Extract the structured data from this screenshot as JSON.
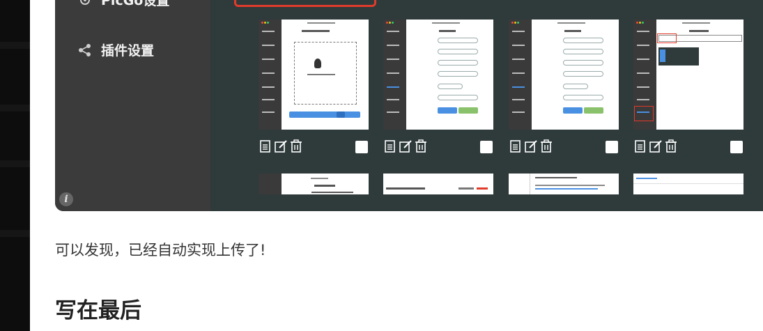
{
  "sidebar": {
    "items": [
      {
        "label": "PicGo设置",
        "icon": "gear-icon"
      },
      {
        "label": "插件设置",
        "icon": "share-icon"
      }
    ]
  },
  "gallery": {
    "row1_count": 4,
    "row2_count": 4,
    "actions": [
      "document-icon",
      "edit-icon",
      "trash-icon"
    ]
  },
  "article": {
    "caption": "可以发现，已经自动实现上传了!",
    "heading": "写在最后"
  },
  "colors": {
    "panel_bg": "#2f3a3b",
    "sidebar_bg": "#3b3b3b",
    "highlight_red": "#e13b2b",
    "accent_blue": "#4a90e2",
    "accent_green": "#8ac16b"
  }
}
